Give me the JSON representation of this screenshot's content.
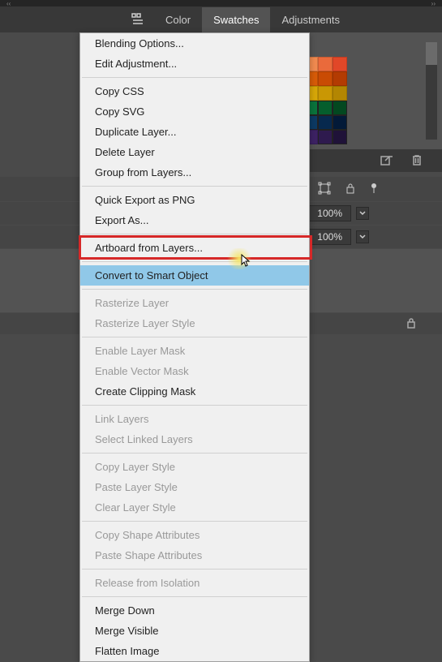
{
  "top_thin_left": "‹‹",
  "top_thin_right": "››",
  "tabs": {
    "color": "Color",
    "swatches": "Swatches",
    "adjustments": "Adjustments"
  },
  "swatch_colors": [
    [
      "#ff0000",
      "#ffff00",
      "#00ff00",
      "#00ffff",
      "#0000ff",
      "#ff00ff"
    ],
    [
      "#ed1c24",
      "#fff200",
      "#00a651",
      "#00aeef",
      "#2e3192",
      "#ec008c",
      "#111",
      "#222",
      "#333",
      "#f7c59f",
      "#f9a870",
      "#f28b50",
      "#ea6a3b",
      "#e14728"
    ],
    [
      "#8a1a12",
      "#a82218",
      "#c62d1d",
      "#d73a23",
      "#e8532a",
      "#111",
      "#222",
      "#333",
      "#f6a623",
      "#f28c1b",
      "#e57311",
      "#d85c08",
      "#c94b04",
      "#b33b02"
    ],
    [
      "#8a3b12",
      "#a84918",
      "#c6571d",
      "#d76423",
      "#e8752a",
      "#111",
      "#222",
      "#333",
      "#f6dd23",
      "#f2cd1b",
      "#e5bb11",
      "#d8a808",
      "#c99704",
      "#b38602"
    ],
    [
      "#4a7a12",
      "#5a9018",
      "#6aa61d",
      "#7ab823",
      "#8aca2a",
      "#111",
      "#222",
      "#333",
      "#23b66d",
      "#1ba05d",
      "#128a4c",
      "#0a743c",
      "#055e2d",
      "#034820"
    ],
    [
      "#125a7a",
      "#186d90",
      "#1d80a6",
      "#2392b8",
      "#2aa4ca",
      "#111",
      "#222",
      "#333",
      "#1d6fa6",
      "#185d90",
      "#124b7a",
      "#0c3a64",
      "#07294e",
      "#031a38"
    ],
    [
      "#3a2a7a",
      "#4a3490",
      "#5a3ea6",
      "#6a48b8",
      "#7a52ca",
      "#111",
      "#222",
      "#333",
      "#6d3aa6",
      "#5d3290",
      "#4d2a7a",
      "#3d2264",
      "#2e1a4e",
      "#1f1238"
    ]
  ],
  "percent_rows": {
    "r1": "100%",
    "r2": "100%"
  },
  "context_menu": {
    "groups": [
      {
        "items": [
          {
            "k": "blending",
            "label": "Blending Options..."
          },
          {
            "k": "edit_adj",
            "label": "Edit Adjustment..."
          }
        ]
      },
      {
        "items": [
          {
            "k": "copy_css",
            "label": "Copy CSS"
          },
          {
            "k": "copy_svg",
            "label": "Copy SVG"
          },
          {
            "k": "dup",
            "label": "Duplicate Layer..."
          },
          {
            "k": "del",
            "label": "Delete Layer"
          },
          {
            "k": "grp",
            "label": "Group from Layers..."
          }
        ]
      },
      {
        "items": [
          {
            "k": "qexp",
            "label": "Quick Export as PNG"
          },
          {
            "k": "expas",
            "label": "Export As..."
          }
        ]
      },
      {
        "items": [
          {
            "k": "artboard",
            "label": "Artboard from Layers..."
          }
        ]
      },
      {
        "items": [
          {
            "k": "smart",
            "label": "Convert to Smart Object",
            "hl": true
          }
        ]
      },
      {
        "items": [
          {
            "k": "rast",
            "label": "Rasterize Layer",
            "dis": true
          },
          {
            "k": "raststyle",
            "label": "Rasterize Layer Style",
            "dis": true
          }
        ]
      },
      {
        "items": [
          {
            "k": "mask",
            "label": "Enable Layer Mask",
            "dis": true
          },
          {
            "k": "vmask",
            "label": "Enable Vector Mask",
            "dis": true
          },
          {
            "k": "clip",
            "label": "Create Clipping Mask"
          }
        ]
      },
      {
        "items": [
          {
            "k": "link",
            "label": "Link Layers",
            "dis": true
          },
          {
            "k": "sellink",
            "label": "Select Linked Layers",
            "dis": true
          }
        ]
      },
      {
        "items": [
          {
            "k": "cpstyle",
            "label": "Copy Layer Style",
            "dis": true
          },
          {
            "k": "pstyle",
            "label": "Paste Layer Style",
            "dis": true
          },
          {
            "k": "clstyle",
            "label": "Clear Layer Style",
            "dis": true
          }
        ]
      },
      {
        "items": [
          {
            "k": "cpshape",
            "label": "Copy Shape Attributes",
            "dis": true
          },
          {
            "k": "pshape",
            "label": "Paste Shape Attributes",
            "dis": true
          }
        ]
      },
      {
        "items": [
          {
            "k": "release",
            "label": "Release from Isolation",
            "dis": true
          }
        ]
      },
      {
        "items": [
          {
            "k": "mdown",
            "label": "Merge Down"
          },
          {
            "k": "mvis",
            "label": "Merge Visible"
          },
          {
            "k": "flat",
            "label": "Flatten Image"
          }
        ]
      }
    ]
  }
}
